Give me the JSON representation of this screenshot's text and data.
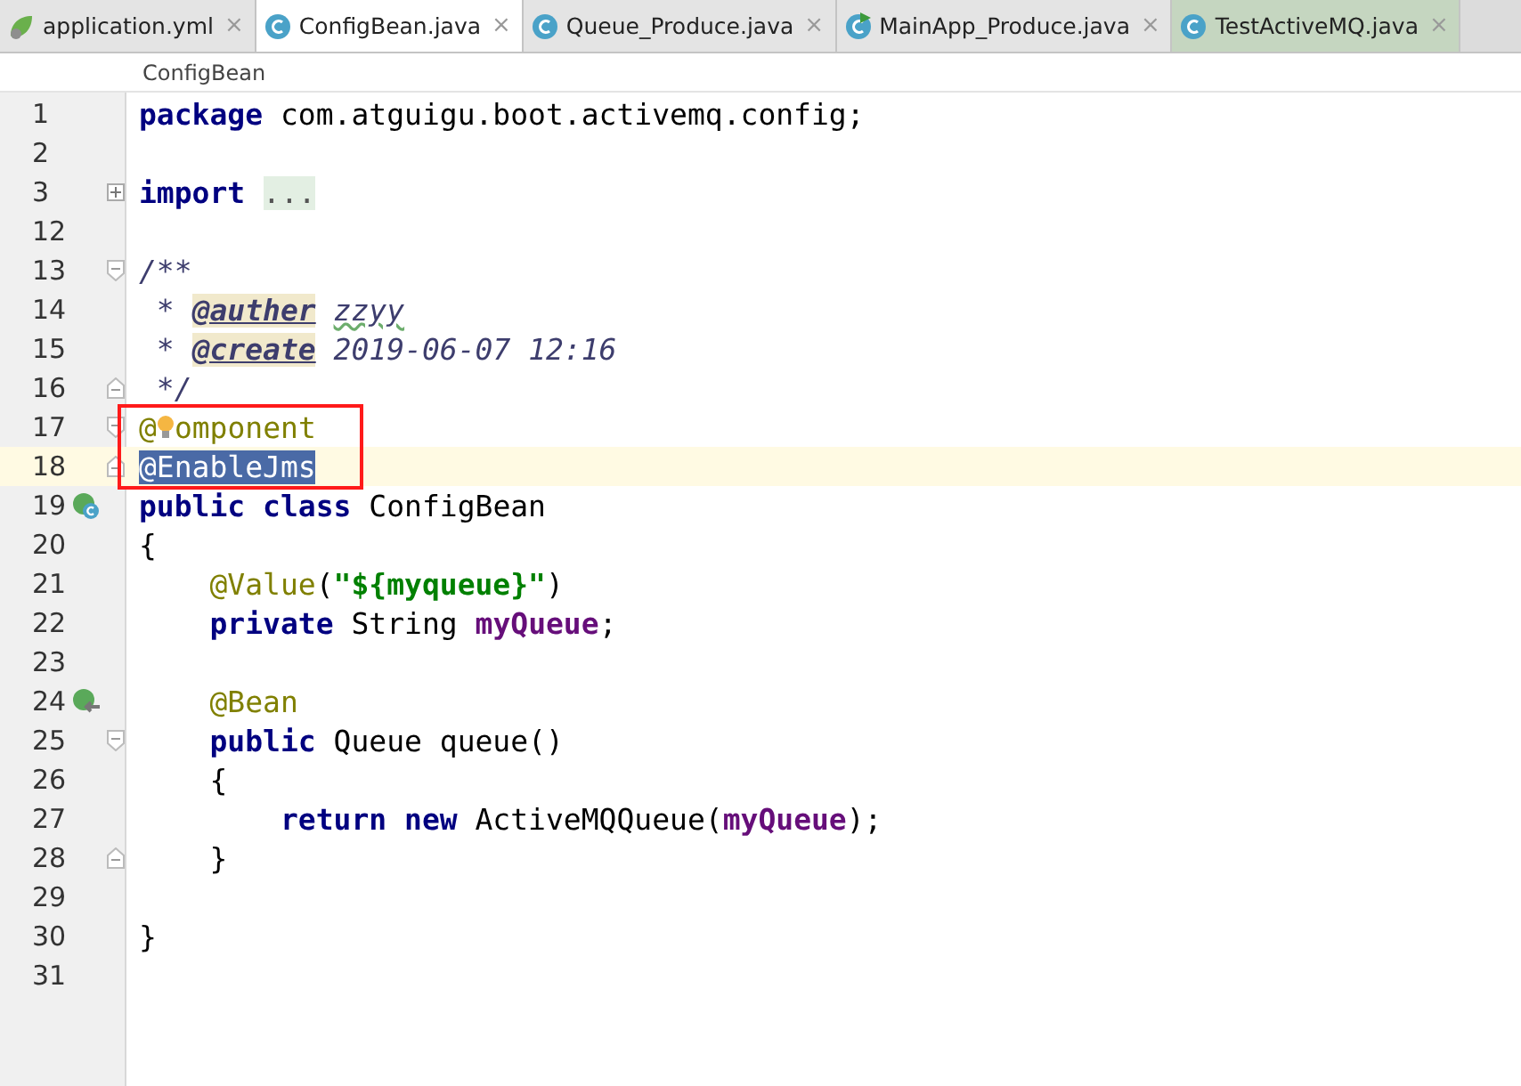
{
  "tabs": [
    {
      "label": "application.yml",
      "kind": "yml",
      "test": false,
      "selected": false
    },
    {
      "label": "ConfigBean.java",
      "kind": "class",
      "test": false,
      "selected": true
    },
    {
      "label": "Queue_Produce.java",
      "kind": "class",
      "test": false,
      "selected": false
    },
    {
      "label": "MainApp_Produce.java",
      "kind": "main-class",
      "test": false,
      "selected": false
    },
    {
      "label": "TestActiveMQ.java",
      "kind": "class",
      "test": true,
      "selected": false
    }
  ],
  "close_glyph": "×",
  "breadcrumb": "ConfigBean",
  "lines": [
    {
      "number": "1",
      "current": false,
      "tokens": [
        {
          "kind": "kw",
          "text": "package"
        },
        {
          "kind": "txt",
          "text": " com.atguigu.boot.activemq.config;"
        }
      ]
    },
    {
      "number": "2",
      "current": false
    },
    {
      "number": "3",
      "current": false,
      "fold": {
        "kind": "collapsed"
      },
      "tokens": [
        {
          "kind": "kw",
          "text": "import"
        },
        {
          "kind": "fold",
          "text": "..."
        }
      ]
    },
    {
      "number": "12",
      "current": false
    },
    {
      "number": "13",
      "current": false,
      "fold": {
        "kind": "start"
      },
      "tokens": [
        {
          "kind": "doc",
          "text": "/**"
        }
      ]
    },
    {
      "number": "14",
      "current": false,
      "tokens": [
        {
          "kind": "doc",
          "text": " * "
        },
        {
          "kind": "tag",
          "text": "@auther"
        },
        {
          "kind": "typo",
          "text": "zzyy"
        }
      ]
    },
    {
      "number": "15",
      "current": false,
      "tokens": [
        {
          "kind": "doc",
          "text": " * "
        },
        {
          "kind": "tag",
          "text": "@create"
        },
        {
          "kind": "doc",
          "text": " 2019-06-07 12:16"
        }
      ]
    },
    {
      "number": "16",
      "current": false,
      "fold": {
        "kind": "end"
      },
      "tokens": [
        {
          "kind": "doc",
          "text": " */"
        }
      ]
    },
    {
      "number": "17",
      "current": false,
      "fold": {
        "kind": "start"
      },
      "boxed": true,
      "tokens": [
        {
          "kind": "ann",
          "text": "@"
        },
        {
          "kind": "bulb"
        },
        {
          "kind": "ann",
          "text": "omponent"
        }
      ]
    },
    {
      "number": "18",
      "current": true,
      "fold": {
        "kind": "end"
      },
      "boxed": true,
      "tokens": [
        {
          "kind": "sel",
          "text": "@EnableJms"
        }
      ]
    },
    {
      "number": "19",
      "current": false,
      "gutter": {
        "kind": "bean-class"
      },
      "tokens": [
        {
          "kind": "kw",
          "text": "public class"
        },
        {
          "kind": "txt",
          "text": " ConfigBean"
        }
      ]
    },
    {
      "number": "20",
      "current": false,
      "tokens": [
        {
          "kind": "txt",
          "text": "{"
        }
      ]
    },
    {
      "number": "21",
      "current": false,
      "tokens": [
        {
          "kind": "ann",
          "text": "    @Value"
        },
        {
          "kind": "txt",
          "text": "("
        },
        {
          "kind": "str",
          "text": "\"${myqueue}\""
        },
        {
          "kind": "txt",
          "text": ")"
        }
      ]
    },
    {
      "number": "22",
      "current": false,
      "tokens": [
        {
          "kind": "kw",
          "text": "    private"
        },
        {
          "kind": "txt",
          "text": " String "
        },
        {
          "kind": "fld",
          "text": "myQueue"
        },
        {
          "kind": "txt",
          "text": ";"
        }
      ]
    },
    {
      "number": "23",
      "current": false
    },
    {
      "number": "24",
      "current": false,
      "gutter": {
        "kind": "bean-method"
      },
      "tokens": [
        {
          "kind": "ann",
          "text": "    @Bean"
        }
      ]
    },
    {
      "number": "25",
      "current": false,
      "fold": {
        "kind": "start"
      },
      "tokens": [
        {
          "kind": "kw",
          "text": "    public"
        },
        {
          "kind": "txt",
          "text": " Queue queue()"
        }
      ]
    },
    {
      "number": "26",
      "current": false,
      "tokens": [
        {
          "kind": "txt",
          "text": "    {"
        }
      ]
    },
    {
      "number": "27",
      "current": false,
      "tokens": [
        {
          "kind": "kw",
          "text": "        return new"
        },
        {
          "kind": "txt",
          "text": " ActiveMQQueue("
        },
        {
          "kind": "fld",
          "text": "myQueue"
        },
        {
          "kind": "txt",
          "text": ");"
        }
      ]
    },
    {
      "number": "28",
      "current": false,
      "fold": {
        "kind": "end"
      },
      "tokens": [
        {
          "kind": "txt",
          "text": "    }"
        }
      ]
    },
    {
      "number": "29",
      "current": false
    },
    {
      "number": "30",
      "current": false,
      "tokens": [
        {
          "kind": "txt",
          "text": "}"
        }
      ]
    },
    {
      "number": "31",
      "current": false
    }
  ]
}
